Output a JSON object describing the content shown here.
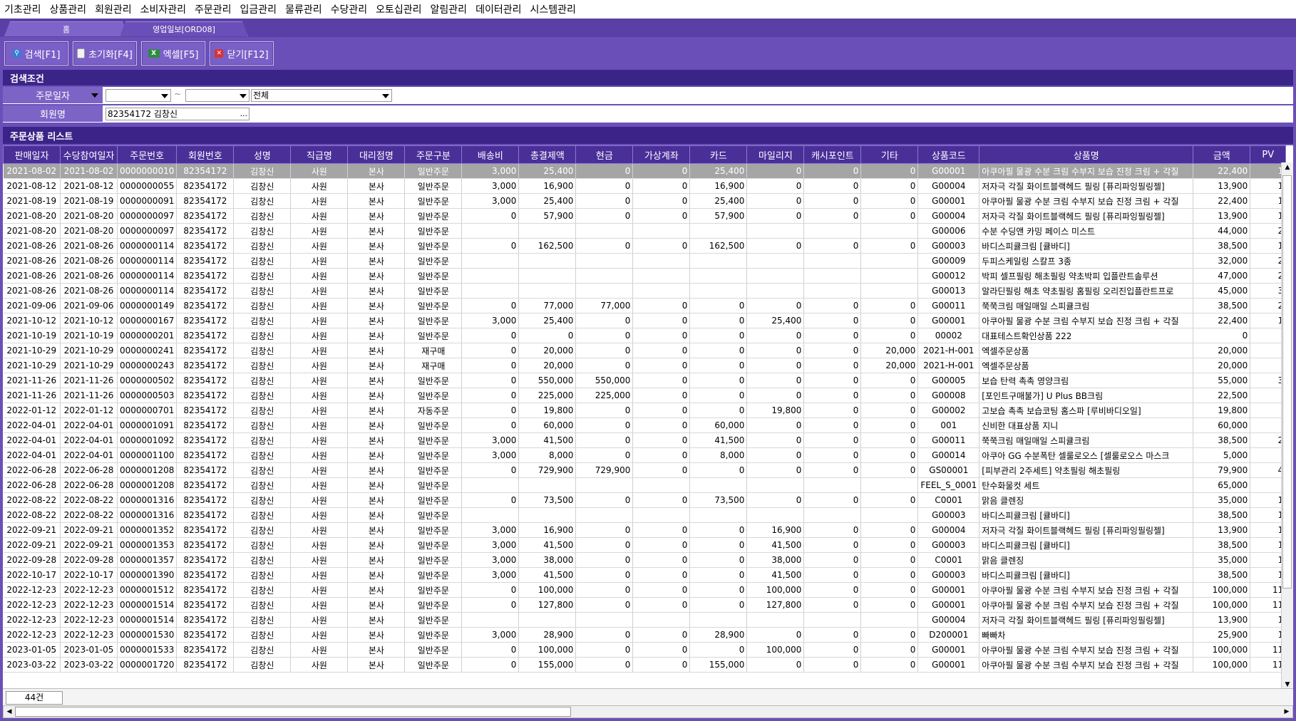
{
  "menu": [
    "기초관리",
    "상품관리",
    "회원관리",
    "소비자관리",
    "주문관리",
    "입금관리",
    "물류관리",
    "수당관리",
    "오토십관리",
    "알림관리",
    "데이터관리",
    "시스템관리"
  ],
  "tabs": {
    "home": "홈",
    "current": "영업일보[ORD08]"
  },
  "toolbar": {
    "search": "검색[F1]",
    "reset": "초기화[F4]",
    "excel": "엑셀[F5]",
    "close": "닫기[F12]"
  },
  "search_section": {
    "title": "검색조건",
    "order_date_label": "주문일자",
    "date_from": "",
    "tilde": "~",
    "date_to": "",
    "type_value": "전체",
    "member_label": "회원명",
    "member_value": "82354172 김창신",
    "member_btn": "..."
  },
  "list_title": "주문상품 리스트",
  "columns": [
    "판매일자",
    "수당참여일자",
    "주문번호",
    "회원번호",
    "성명",
    "직급명",
    "대리점명",
    "주문구분",
    "배송비",
    "총결제액",
    "현금",
    "가상계좌",
    "카드",
    "마일리지",
    "캐시포인트",
    "기타",
    "상품코드",
    "상품명",
    "금액",
    "PV"
  ],
  "rows": [
    [
      "2021-08-02",
      "2021-08-02",
      "0000000010",
      "82354172",
      "김창신",
      "사원",
      "본사",
      "일반주문",
      "3,000",
      "25,400",
      "0",
      "0",
      "25,400",
      "0",
      "0",
      "0",
      "G00001",
      "아쿠아필 물광 수분 크림 수부지 보습 진정 크림 + 각질",
      "22,400",
      "1"
    ],
    [
      "2021-08-12",
      "2021-08-12",
      "0000000055",
      "82354172",
      "김창신",
      "사원",
      "본사",
      "일반주문",
      "3,000",
      "16,900",
      "0",
      "0",
      "16,900",
      "0",
      "0",
      "0",
      "G00004",
      "저자극 각질 화이트블랙헤드 필링 [퓨리파잉필링젤]",
      "13,900",
      "1"
    ],
    [
      "2021-08-19",
      "2021-08-19",
      "0000000091",
      "82354172",
      "김창신",
      "사원",
      "본사",
      "일반주문",
      "3,000",
      "25,400",
      "0",
      "0",
      "25,400",
      "0",
      "0",
      "0",
      "G00001",
      "아쿠아필 물광 수분 크림 수부지 보습 진정 크림 + 각질",
      "22,400",
      "1"
    ],
    [
      "2021-08-20",
      "2021-08-20",
      "0000000097",
      "82354172",
      "김창신",
      "사원",
      "본사",
      "일반주문",
      "0",
      "57,900",
      "0",
      "0",
      "57,900",
      "0",
      "0",
      "0",
      "G00004",
      "저자극 각질 화이트블랙헤드 필링 [퓨리파잉필링젤]",
      "13,900",
      "1"
    ],
    [
      "2021-08-20",
      "2021-08-20",
      "0000000097",
      "82354172",
      "김창신",
      "사원",
      "본사",
      "일반주문",
      "",
      "",
      "",
      "",
      "",
      "",
      "",
      "",
      "G00006",
      "수분 수딩앤 카밍 페이스 미스트",
      "44,000",
      "2"
    ],
    [
      "2021-08-26",
      "2021-08-26",
      "0000000114",
      "82354172",
      "김창신",
      "사원",
      "본사",
      "일반주문",
      "0",
      "162,500",
      "0",
      "0",
      "162,500",
      "0",
      "0",
      "0",
      "G00003",
      "바디스피큘크림 [큘바디]",
      "38,500",
      "1"
    ],
    [
      "2021-08-26",
      "2021-08-26",
      "0000000114",
      "82354172",
      "김창신",
      "사원",
      "본사",
      "일반주문",
      "",
      "",
      "",
      "",
      "",
      "",
      "",
      "",
      "G00009",
      "두피스케일링 스칼프 3종",
      "32,000",
      "2"
    ],
    [
      "2021-08-26",
      "2021-08-26",
      "0000000114",
      "82354172",
      "김창신",
      "사원",
      "본사",
      "일반주문",
      "",
      "",
      "",
      "",
      "",
      "",
      "",
      "",
      "G00012",
      "박피 셀프필링 해초필링 약초박피 입플란트솔루션",
      "47,000",
      "2"
    ],
    [
      "2021-08-26",
      "2021-08-26",
      "0000000114",
      "82354172",
      "김창신",
      "사원",
      "본사",
      "일반주문",
      "",
      "",
      "",
      "",
      "",
      "",
      "",
      "",
      "G00013",
      "알라딘필링 해초 약초필링 홈필링 오리진입플란트프로",
      "45,000",
      "3"
    ],
    [
      "2021-09-06",
      "2021-09-06",
      "0000000149",
      "82354172",
      "김창신",
      "사원",
      "본사",
      "일반주문",
      "0",
      "77,000",
      "77,000",
      "0",
      "0",
      "0",
      "0",
      "0",
      "G00011",
      "쭉쭉크림 매일매일 스피큘크림",
      "38,500",
      "2"
    ],
    [
      "2021-10-12",
      "2021-10-12",
      "0000000167",
      "82354172",
      "김창신",
      "사원",
      "본사",
      "일반주문",
      "3,000",
      "25,400",
      "0",
      "0",
      "0",
      "25,400",
      "0",
      "0",
      "G00001",
      "아쿠아필 물광 수분 크림 수부지 보습 진정 크림 + 각질",
      "22,400",
      "1"
    ],
    [
      "2021-10-19",
      "2021-10-19",
      "0000000201",
      "82354172",
      "김창신",
      "사원",
      "본사",
      "일반주문",
      "0",
      "0",
      "0",
      "0",
      "0",
      "0",
      "0",
      "0",
      "00002",
      "대표테스트확인상품 222",
      "0",
      ""
    ],
    [
      "2021-10-29",
      "2021-10-29",
      "0000000241",
      "82354172",
      "김창신",
      "사원",
      "본사",
      "재구매",
      "0",
      "20,000",
      "0",
      "0",
      "0",
      "0",
      "0",
      "20,000",
      "2021-H-001",
      "엑셀주문상품",
      "20,000",
      ""
    ],
    [
      "2021-10-29",
      "2021-10-29",
      "0000000243",
      "82354172",
      "김창신",
      "사원",
      "본사",
      "재구매",
      "0",
      "20,000",
      "0",
      "0",
      "0",
      "0",
      "0",
      "20,000",
      "2021-H-001",
      "엑셀주문상품",
      "20,000",
      ""
    ],
    [
      "2021-11-26",
      "2021-11-26",
      "0000000502",
      "82354172",
      "김창신",
      "사원",
      "본사",
      "일반주문",
      "0",
      "550,000",
      "550,000",
      "0",
      "0",
      "0",
      "0",
      "0",
      "G00005",
      "보습 탄력 촉촉 영양크림",
      "55,000",
      "3"
    ],
    [
      "2021-11-26",
      "2021-11-26",
      "0000000503",
      "82354172",
      "김창신",
      "사원",
      "본사",
      "일반주문",
      "0",
      "225,000",
      "225,000",
      "0",
      "0",
      "0",
      "0",
      "0",
      "G00008",
      "[포인트구매불가] U Plus BB크림",
      "22,500",
      ""
    ],
    [
      "2022-01-12",
      "2022-01-12",
      "0000000701",
      "82354172",
      "김창신",
      "사원",
      "본사",
      "자동주문",
      "0",
      "19,800",
      "0",
      "0",
      "0",
      "19,800",
      "0",
      "0",
      "G00002",
      "고보습 촉촉 보습코팅 홈스파 [루비바디오일]",
      "19,800",
      ""
    ],
    [
      "2022-04-01",
      "2022-04-01",
      "0000001091",
      "82354172",
      "김창신",
      "사원",
      "본사",
      "일반주문",
      "0",
      "60,000",
      "0",
      "0",
      "60,000",
      "0",
      "0",
      "0",
      "001",
      "신비한 대표상품 지니",
      "60,000",
      ""
    ],
    [
      "2022-04-01",
      "2022-04-01",
      "0000001092",
      "82354172",
      "김창신",
      "사원",
      "본사",
      "일반주문",
      "3,000",
      "41,500",
      "0",
      "0",
      "41,500",
      "0",
      "0",
      "0",
      "G00011",
      "쭉쭉크림 매일매일 스피큘크림",
      "38,500",
      "2"
    ],
    [
      "2022-04-01",
      "2022-04-01",
      "0000001100",
      "82354172",
      "김창신",
      "사원",
      "본사",
      "일반주문",
      "3,000",
      "8,000",
      "0",
      "0",
      "8,000",
      "0",
      "0",
      "0",
      "G00014",
      "아쿠아 GG 수분폭탄 셀룰로오스 [셀룰로오스 마스크",
      "5,000",
      ""
    ],
    [
      "2022-06-28",
      "2022-06-28",
      "0000001208",
      "82354172",
      "김창신",
      "사원",
      "본사",
      "일반주문",
      "0",
      "729,900",
      "729,900",
      "0",
      "0",
      "0",
      "0",
      "0",
      "GS00001",
      "[피부관리 2주세트] 약초필링 해초필링",
      "79,900",
      "4"
    ],
    [
      "2022-06-28",
      "2022-06-28",
      "0000001208",
      "82354172",
      "김창신",
      "사원",
      "본사",
      "일반주문",
      "",
      "",
      "",
      "",
      "",
      "",
      "",
      "",
      "FEEL_S_0001",
      "탄수화물컷 세트",
      "65,000",
      ""
    ],
    [
      "2022-08-22",
      "2022-08-22",
      "0000001316",
      "82354172",
      "김창신",
      "사원",
      "본사",
      "일반주문",
      "0",
      "73,500",
      "0",
      "0",
      "73,500",
      "0",
      "0",
      "0",
      "C0001",
      "맑음 클렌징",
      "35,000",
      "1"
    ],
    [
      "2022-08-22",
      "2022-08-22",
      "0000001316",
      "82354172",
      "김창신",
      "사원",
      "본사",
      "일반주문",
      "",
      "",
      "",
      "",
      "",
      "",
      "",
      "",
      "G00003",
      "바디스피큘크림 [큘바디]",
      "38,500",
      "1"
    ],
    [
      "2022-09-21",
      "2022-09-21",
      "0000001352",
      "82354172",
      "김창신",
      "사원",
      "본사",
      "일반주문",
      "3,000",
      "16,900",
      "0",
      "0",
      "0",
      "16,900",
      "0",
      "0",
      "G00004",
      "저자극 각질 화이트블랙헤드 필링 [퓨리파잉필링젤]",
      "13,900",
      "1"
    ],
    [
      "2022-09-21",
      "2022-09-21",
      "0000001353",
      "82354172",
      "김창신",
      "사원",
      "본사",
      "일반주문",
      "3,000",
      "41,500",
      "0",
      "0",
      "0",
      "41,500",
      "0",
      "0",
      "G00003",
      "바디스피큘크림 [큘바디]",
      "38,500",
      "1"
    ],
    [
      "2022-09-28",
      "2022-09-28",
      "0000001357",
      "82354172",
      "김창신",
      "사원",
      "본사",
      "일반주문",
      "3,000",
      "38,000",
      "0",
      "0",
      "0",
      "38,000",
      "0",
      "0",
      "C0001",
      "맑음 클렌징",
      "35,000",
      "1"
    ],
    [
      "2022-10-17",
      "2022-10-17",
      "0000001390",
      "82354172",
      "김창신",
      "사원",
      "본사",
      "일반주문",
      "3,000",
      "41,500",
      "0",
      "0",
      "0",
      "41,500",
      "0",
      "0",
      "G00003",
      "바디스피큘크림 [큘바디]",
      "38,500",
      "1"
    ],
    [
      "2022-12-23",
      "2022-12-23",
      "0000001512",
      "82354172",
      "김창신",
      "사원",
      "본사",
      "일반주문",
      "0",
      "100,000",
      "0",
      "0",
      "0",
      "100,000",
      "0",
      "0",
      "G00001",
      "아쿠아필 물광 수분 크림 수부지 보습 진정 크림 + 각질",
      "100,000",
      "11"
    ],
    [
      "2022-12-23",
      "2022-12-23",
      "0000001514",
      "82354172",
      "김창신",
      "사원",
      "본사",
      "일반주문",
      "0",
      "127,800",
      "0",
      "0",
      "0",
      "127,800",
      "0",
      "0",
      "G00001",
      "아쿠아필 물광 수분 크림 수부지 보습 진정 크림 + 각질",
      "100,000",
      "11"
    ],
    [
      "2022-12-23",
      "2022-12-23",
      "0000001514",
      "82354172",
      "김창신",
      "사원",
      "본사",
      "일반주문",
      "",
      "",
      "",
      "",
      "",
      "",
      "",
      "",
      "G00004",
      "저자극 각질 화이트블랙헤드 필링 [퓨리파잉필링젤]",
      "13,900",
      "1"
    ],
    [
      "2022-12-23",
      "2022-12-23",
      "0000001530",
      "82354172",
      "김창신",
      "사원",
      "본사",
      "일반주문",
      "3,000",
      "28,900",
      "0",
      "0",
      "28,900",
      "0",
      "0",
      "0",
      "D200001",
      "빠빠차",
      "25,900",
      "1"
    ],
    [
      "2023-01-05",
      "2023-01-05",
      "0000001533",
      "82354172",
      "김창신",
      "사원",
      "본사",
      "일반주문",
      "0",
      "100,000",
      "0",
      "0",
      "0",
      "100,000",
      "0",
      "0",
      "G00001",
      "아쿠아필 물광 수분 크림 수부지 보습 진정 크림 + 각질",
      "100,000",
      "11"
    ],
    [
      "2023-03-22",
      "2023-03-22",
      "0000001720",
      "82354172",
      "김창신",
      "사원",
      "본사",
      "일반주문",
      "0",
      "155,000",
      "0",
      "0",
      "155,000",
      "0",
      "0",
      "0",
      "G00001",
      "아쿠아필 물광 수분 크림 수부지 보습 진정 크림 + 각질",
      "100,000",
      "11"
    ]
  ],
  "selected_row": 0,
  "footer": {
    "count": "44건"
  },
  "colors": {
    "bg": "#6b4fb8",
    "header": "#4a2f99",
    "section": "#3b2487",
    "selected": "#a5a5a5"
  }
}
